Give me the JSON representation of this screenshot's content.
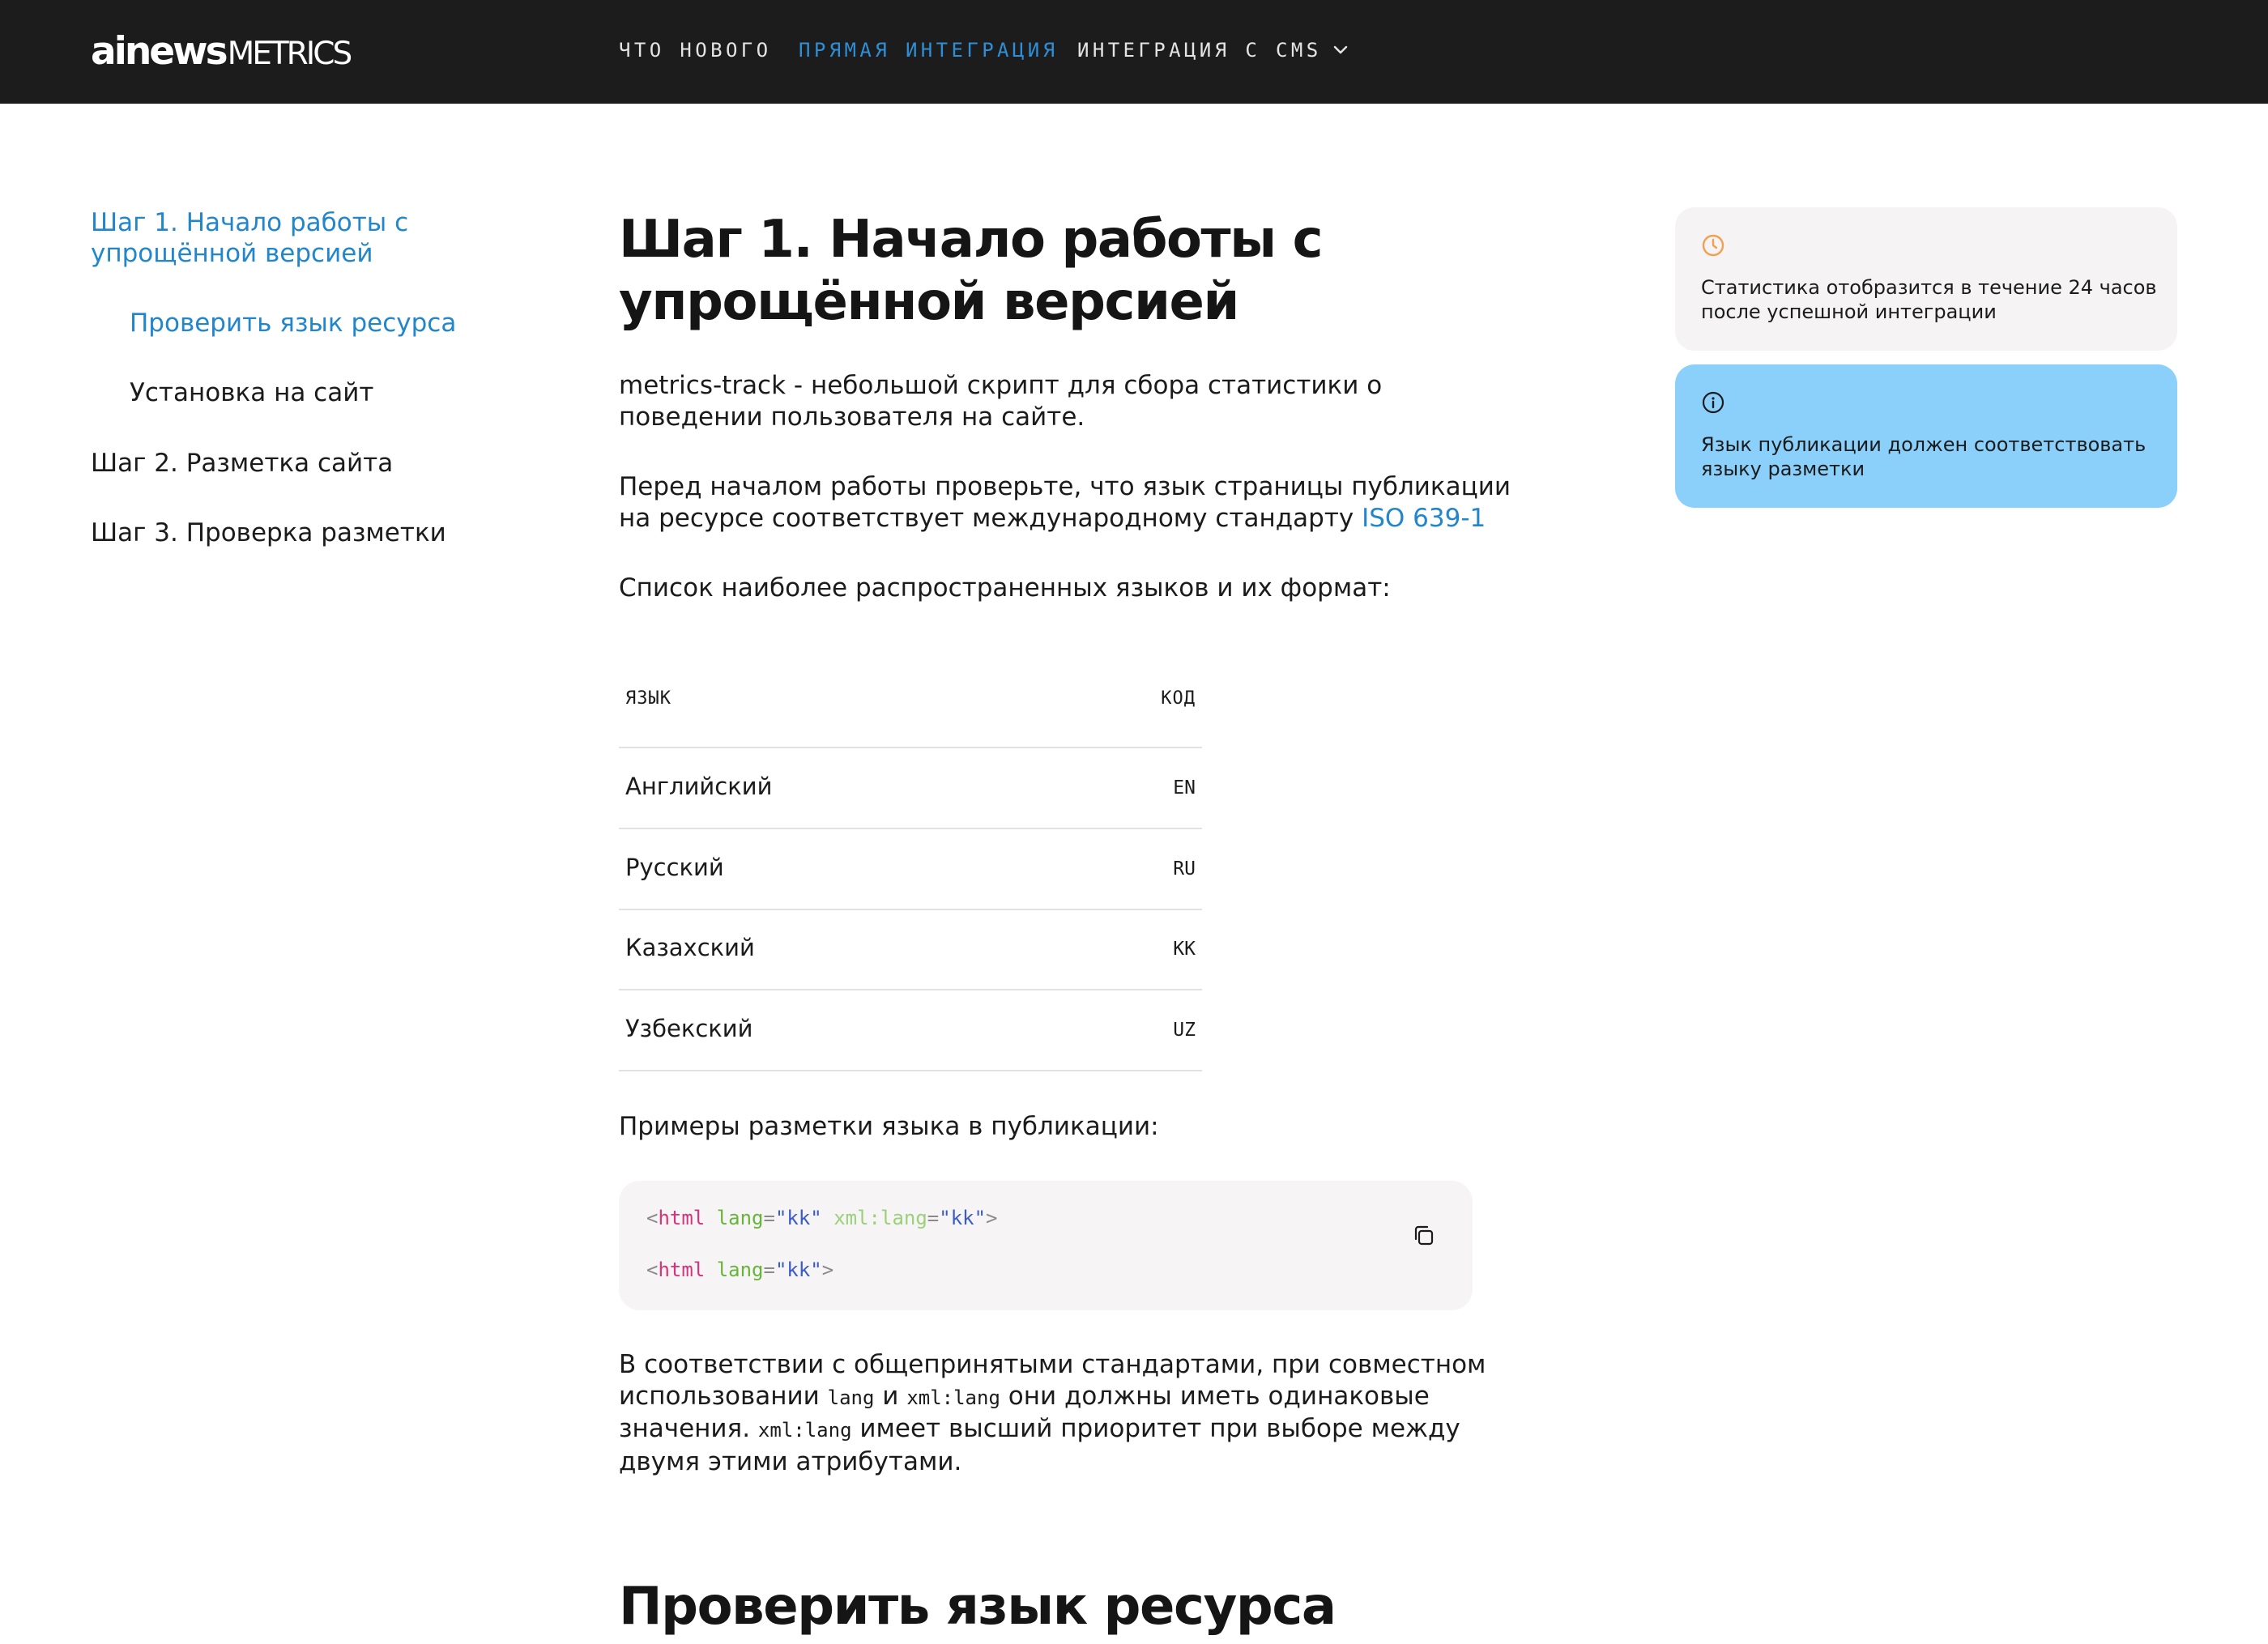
{
  "header": {
    "logo_primary": "ainews",
    "logo_secondary": "METRICS",
    "nav": [
      {
        "label": "ЧТО НОВОГО"
      },
      {
        "label": "ПРЯМАЯ ИНТЕГРАЦИЯ",
        "active": true
      },
      {
        "label": "ИНТЕГРАЦИЯ С CMS"
      }
    ],
    "dropdown_icon": "chevron-down-icon"
  },
  "sidebar": {
    "items": [
      {
        "label_line1": "Шаг 1. Начало работы с",
        "label_line2": "упрощённой версией",
        "active": true
      },
      {
        "label": "Проверить язык ресурса",
        "active": true,
        "sub": true
      },
      {
        "label": "Установка на сайт",
        "sub": true
      },
      {
        "label": "Шаг 2. Разметка сайта"
      },
      {
        "label": "Шаг 3. Проверка разметки"
      }
    ]
  },
  "main": {
    "title_line1": "Шаг 1. Начало работы с",
    "title_line2": "упрощённой версией",
    "intro_line1": "metrics-track - небольшой скрипт для сбора статистики о",
    "intro_line2": "поведении пользователя на сайте.",
    "check_line1": "Перед началом работы проверьте, что язык страницы публикации",
    "check_line2": "на ресурсе соответствует международному стандарту ",
    "iso_link": "ISO 639-1",
    "list_intro": "Список наиболее распространенных языков и их формат:",
    "table": {
      "headers": [
        "ЯЗЫК",
        "КОД"
      ],
      "rows": [
        {
          "language": "Английский",
          "code": "EN"
        },
        {
          "language": "Русский",
          "code": "RU"
        },
        {
          "language": "Казахский",
          "code": "KK"
        },
        {
          "language": "Узбекский",
          "code": "UZ"
        }
      ]
    },
    "examples_intro": "Примеры разметки языка в публикации:",
    "code": {
      "line1": {
        "open": "<",
        "tag": "html",
        "attr1": "lang",
        "eq": "=",
        "val1": "\"kk\"",
        "attr2": "xml:lang",
        "val2": "\"kk\"",
        "close": ">"
      },
      "line2": {
        "open": "<",
        "tag": "html",
        "attr1": "lang",
        "eq": "=",
        "val1": "\"kk\"",
        "close": ">"
      },
      "copy_icon": "copy-icon"
    },
    "note": {
      "l1": "В соответствии с общепринятыми стандартами, при совместном",
      "l2_a": "использовании ",
      "l2_code1": "lang",
      "l2_b": " и ",
      "l2_code2": "xml:lang",
      "l2_c": " они должны иметь одинаковые",
      "l3_a": "значения. ",
      "l3_code": "xml:lang",
      "l3_b": " имеет высший приоритет при выборе между",
      "l4": "двумя этими атрибутами."
    },
    "section2_title": "Проверить язык ресурса"
  },
  "callouts": [
    {
      "icon": "clock-icon",
      "text": "Статистика отобразится в течение 24 часов после успешной интеграции",
      "background": "#f5f3f3",
      "icon_color": "#f0a050"
    },
    {
      "icon": "info-icon",
      "text": "Язык публикации должен соответствовать языку разметки",
      "background": "#8ad0fb",
      "icon_color": "#1b1b1b"
    }
  ],
  "colors": {
    "header_bg": "#1c1c1c",
    "accent": "#2286cc",
    "nav_active": "#2f8fd6"
  }
}
